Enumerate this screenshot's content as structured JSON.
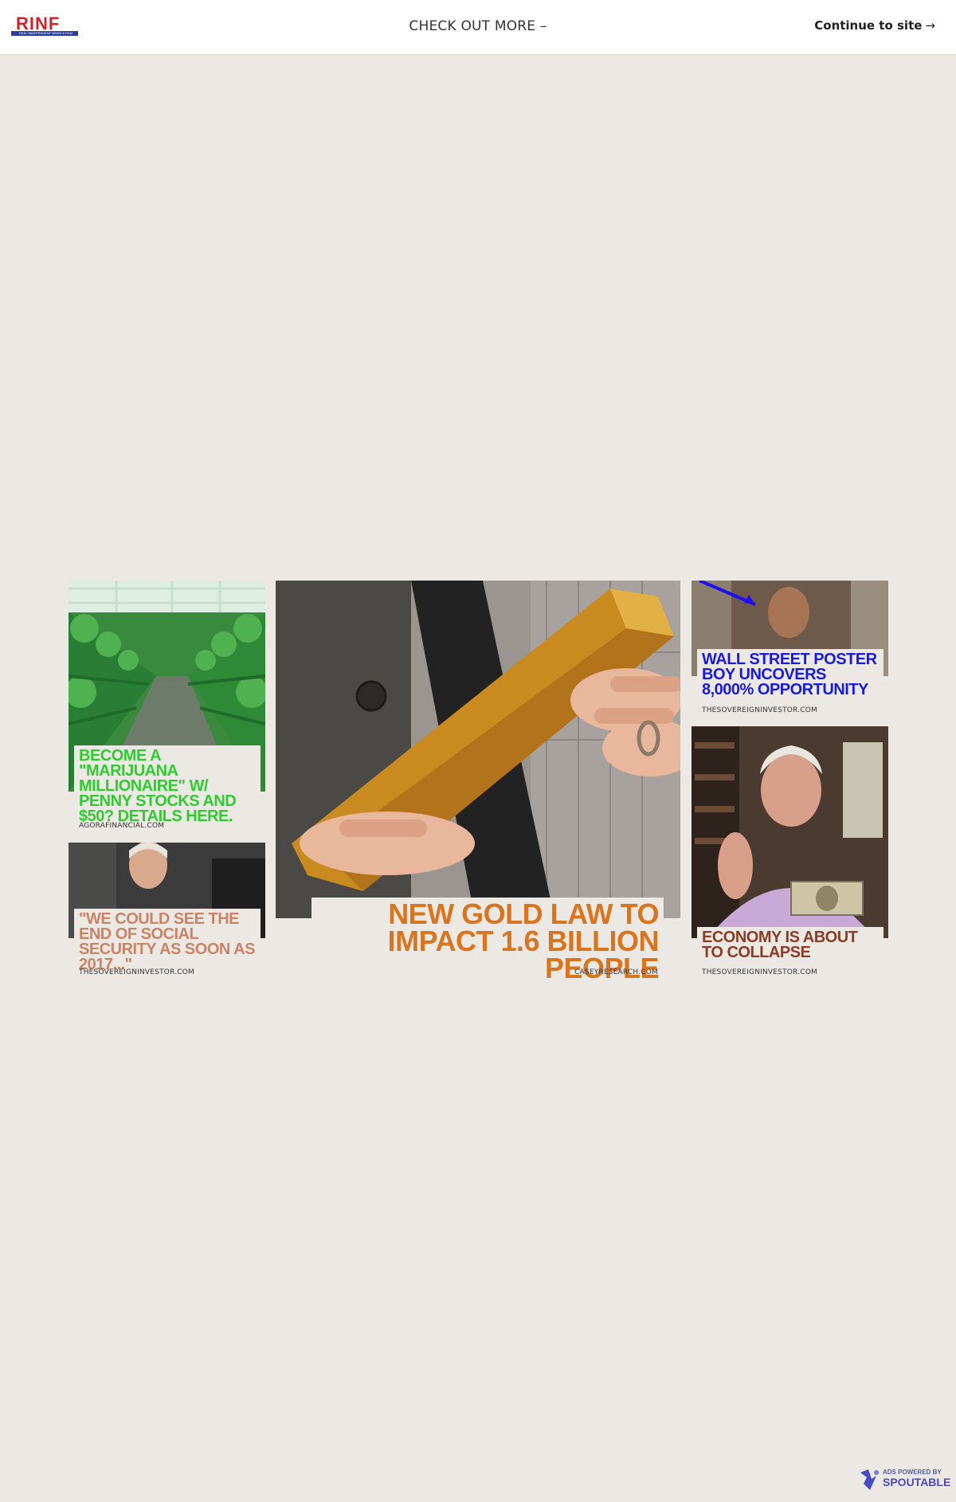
{
  "header": {
    "logo_text": "RINF",
    "logo_subtitle": "REAL INDEPENDENT NEWS & FILM",
    "center_text": "CHECK OUT MORE –",
    "continue_label": "Continue to site",
    "continue_arrow": "→"
  },
  "ads": [
    {
      "title": "BECOME A \"MARIJUANA MILLIONAIRE\" W/ PENNY STOCKS AND $50? DETAILS HERE.",
      "source": "AGORAFINANCIAL.COM",
      "color": "#2ecc2e"
    },
    {
      "title": "\"WE COULD SEE THE END OF SOCIAL SECURITY AS SOON AS 2017...\"",
      "source": "THESOVEREIGNINVESTOR.COM",
      "color": "#c98466"
    },
    {
      "title": "NEW GOLD LAW TO IMPACT 1.6 BILLION PEOPLE",
      "source": "CASEYRESEARCH.COM",
      "color": "#d9741f"
    },
    {
      "title": "WALL STREET POSTER BOY UNCOVERS 8,000% OPPORTUNITY",
      "source": "THESOVEREIGNINVESTOR.COM",
      "color": "#1a1ad9"
    },
    {
      "title": "ECONOMY IS ABOUT TO COLLAPSE",
      "source": "THESOVEREIGNINVESTOR.COM",
      "color": "#8a3c26"
    }
  ],
  "footer": {
    "powered_small": "ADS POWERED BY",
    "powered_brand": "SPOUTABLE"
  }
}
